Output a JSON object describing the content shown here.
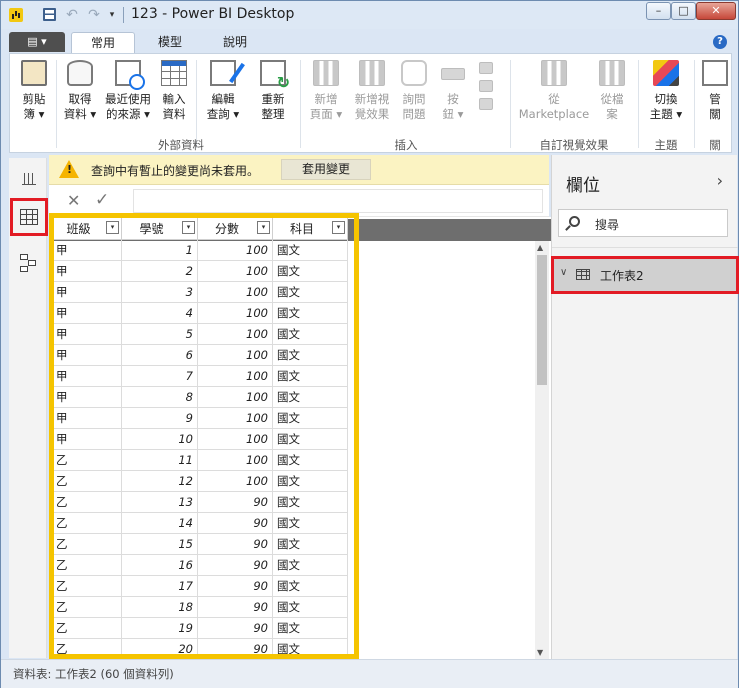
{
  "window": {
    "title": "123 - Power BI Desktop",
    "buttons": {
      "minimize": "–",
      "maximize": "□",
      "close": "✕"
    }
  },
  "quick_access": {
    "undo": "↶",
    "redo": "↷",
    "more": "▾"
  },
  "ribbon_tabs": {
    "file": "▤ ▾",
    "home": "常用",
    "model": "模型",
    "help": "說明",
    "help_icon": "?"
  },
  "ribbon": {
    "clipboard": {
      "paste": "剪貼\n簿 ▾"
    },
    "external_data": {
      "get_data": "取得\n資料 ▾",
      "recent_sources": "最近使用\n的來源 ▾",
      "enter_data": "輸入\n資料",
      "edit_queries": "編輯\n查詢 ▾",
      "refresh": "重新\n整理",
      "group_label": "外部資料"
    },
    "insert": {
      "new_page": "新增\n頁面 ▾",
      "new_visual": "新增視\n覺效果",
      "ask_question": "詢問\n問題",
      "buttons": "按\n鈕 ▾",
      "group_label": "插入"
    },
    "custom_visuals": {
      "from_marketplace": "從\nMarketplace",
      "from_file": "從檔\n案",
      "group_label": "自訂視覺效果"
    },
    "themes": {
      "switch_theme": "切換\n主題 ▾",
      "group_label": "主題"
    },
    "relationships": {
      "manage": "管\n關",
      "group_label": "關"
    }
  },
  "warning": {
    "message": "查詢中有暫止的變更尚未套用。",
    "apply_button": "套用變更"
  },
  "formula_bar": {
    "cancel": "✕",
    "confirm": "✓"
  },
  "table": {
    "headers": [
      "班級",
      "學號",
      "分數",
      "科目"
    ],
    "filter_glyph": "▾",
    "rows": [
      [
        "甲",
        "1",
        "100",
        "國文"
      ],
      [
        "甲",
        "2",
        "100",
        "國文"
      ],
      [
        "甲",
        "3",
        "100",
        "國文"
      ],
      [
        "甲",
        "4",
        "100",
        "國文"
      ],
      [
        "甲",
        "5",
        "100",
        "國文"
      ],
      [
        "甲",
        "6",
        "100",
        "國文"
      ],
      [
        "甲",
        "7",
        "100",
        "國文"
      ],
      [
        "甲",
        "8",
        "100",
        "國文"
      ],
      [
        "甲",
        "9",
        "100",
        "國文"
      ],
      [
        "甲",
        "10",
        "100",
        "國文"
      ],
      [
        "乙",
        "11",
        "100",
        "國文"
      ],
      [
        "乙",
        "12",
        "100",
        "國文"
      ],
      [
        "乙",
        "13",
        "90",
        "國文"
      ],
      [
        "乙",
        "14",
        "90",
        "國文"
      ],
      [
        "乙",
        "15",
        "90",
        "國文"
      ],
      [
        "乙",
        "16",
        "90",
        "國文"
      ],
      [
        "乙",
        "17",
        "90",
        "國文"
      ],
      [
        "乙",
        "18",
        "90",
        "國文"
      ],
      [
        "乙",
        "19",
        "90",
        "國文"
      ],
      [
        "乙",
        "20",
        "90",
        "國文"
      ]
    ]
  },
  "fields_pane": {
    "title": "欄位",
    "collapse_glyph": "›",
    "search_placeholder": "搜尋",
    "table_name": "工作表2",
    "expand_glyph": "∨"
  },
  "status_bar": {
    "text": "資料表: 工作表2 (60 個資料列)"
  }
}
